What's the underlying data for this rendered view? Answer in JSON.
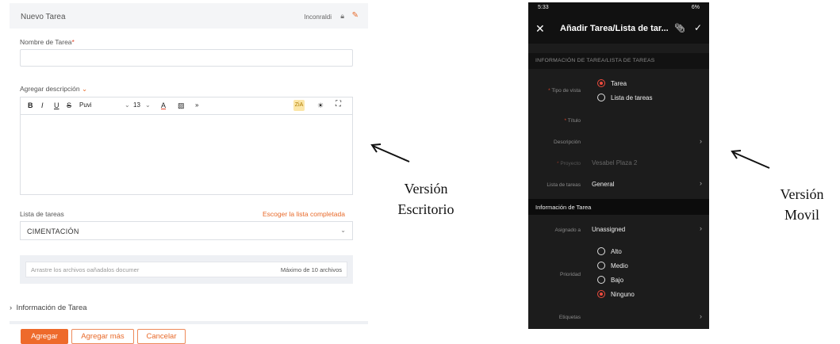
{
  "desktop": {
    "header_title": "Nuevo Tarea",
    "header_status": "Inconraldi",
    "task_name_label": "Nombre de Tarea",
    "required_mark": "*",
    "description_label": "Agregar descripción",
    "toolbar": {
      "bold": "B",
      "italic": "I",
      "underline": "U",
      "strike": "S",
      "font": "Puvi",
      "size": "13",
      "text_color": "A",
      "more": "»",
      "highlight": "ZiA"
    },
    "task_list_label": "Lista de tareas",
    "choose_completed_link": "Escoger la lista completada",
    "task_list_value": "CIMENTACIÓN",
    "drop_text": "Arrastre los archivos oañadalos documer",
    "drop_max": "Máximo de 10 archivos",
    "task_info_toggle": "Información de Tarea",
    "buttons": {
      "add": "Agregar",
      "add_more": "Agregar más",
      "cancel": "Cancelar"
    }
  },
  "annotations": {
    "desktop_line1": "Versión",
    "desktop_line2": "Escritorio",
    "mobile_line1": "Versión",
    "mobile_line2": "Movil"
  },
  "mobile": {
    "status_time": "5:33",
    "status_right": "6%",
    "title": "Añadir Tarea/Lista de tar...",
    "section_task_info": "INFORMACIÓN DE TAREA/LISTA DE TAREAS",
    "view_type_label": "Tipo de vista",
    "view_options": [
      "Tarea",
      "Lista de tareas"
    ],
    "title_label": "Título",
    "description_label": "Descripción",
    "project_label": "Proyecto",
    "project_value": "Vesabel Plaza 2",
    "task_list_label": "Lista de tareas",
    "task_list_value": "General",
    "section_task_details": "Información de Tarea",
    "assigned_label": "Asignado a",
    "assigned_value": "Unassigned",
    "priority_label": "Prioridad",
    "priority_options": [
      "Alto",
      "Medio",
      "Bajo",
      "Ninguno"
    ],
    "tags_label": "Etiquetas",
    "colors": {
      "accent": "#ef4b3d",
      "background": "#1c1c1c"
    }
  }
}
